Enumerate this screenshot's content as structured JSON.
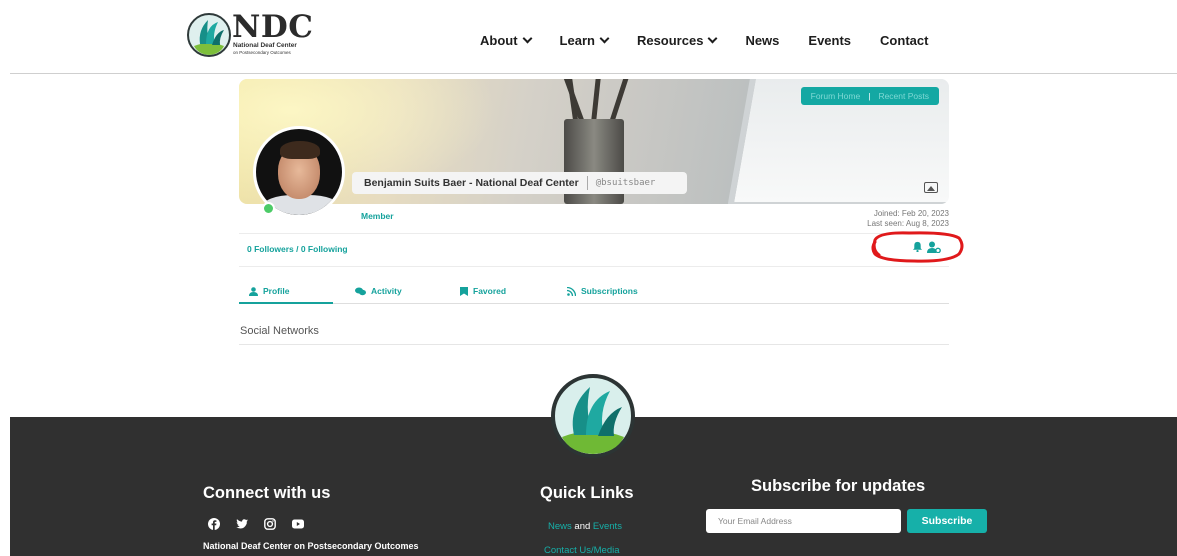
{
  "header": {
    "logo": {
      "text": "NDC",
      "subtitle": "National Deaf Center",
      "tagline": "on Postsecondary Outcomes"
    },
    "nav": [
      {
        "label": "About",
        "dropdown": true
      },
      {
        "label": "Learn",
        "dropdown": true
      },
      {
        "label": "Resources",
        "dropdown": true
      },
      {
        "label": "News",
        "dropdown": false
      },
      {
        "label": "Events",
        "dropdown": false
      },
      {
        "label": "Contact",
        "dropdown": false
      }
    ]
  },
  "profile": {
    "cover_links": {
      "forum_home": "Forum Home",
      "recent_posts": "Recent Posts"
    },
    "name": "Benjamin Suits Baer - National Deaf Center",
    "handle": "@bsuitsbaer",
    "role": "Member",
    "joined": "Joined: Feb 20, 2023",
    "last_seen": "Last seen: Aug 8, 2023",
    "followers": "0 Followers / 0 Following",
    "online": true,
    "tabs": [
      {
        "label": "Profile",
        "icon": "user-icon",
        "active": true
      },
      {
        "label": "Activity",
        "icon": "comments-icon",
        "active": false
      },
      {
        "label": "Favored",
        "icon": "bookmark-icon",
        "active": false
      },
      {
        "label": "Subscriptions",
        "icon": "rss-icon",
        "active": false
      }
    ],
    "section_title": "Social Networks"
  },
  "footer": {
    "connect_title": "Connect with us",
    "social_icons": [
      "facebook-icon",
      "twitter-icon",
      "instagram-icon",
      "youtube-icon"
    ],
    "org_name": "National Deaf Center on Postsecondary Outcomes",
    "quick_links_title": "Quick Links",
    "quick_links": {
      "news": "News",
      "and": "and",
      "events": "Events",
      "contact": "Contact Us/Media"
    },
    "subscribe_title": "Subscribe for updates",
    "email_placeholder": "Your Email Address",
    "subscribe_button": "Subscribe"
  },
  "colors": {
    "accent": "#15a29c",
    "footer_bg": "#303030",
    "annotation": "#e0191b",
    "online": "#4ccb67"
  }
}
